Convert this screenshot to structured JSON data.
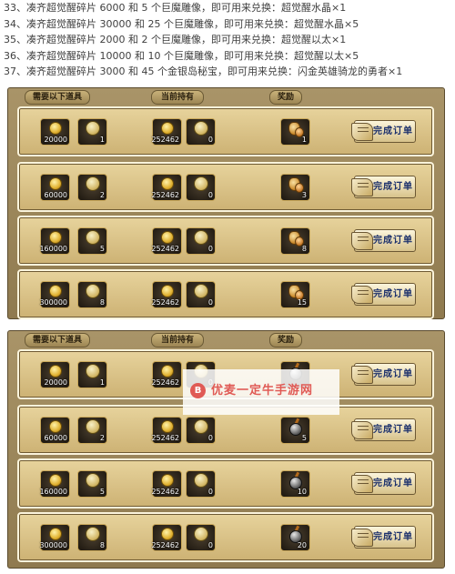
{
  "intro_lines": [
    "33、凑齐超觉醒碎片 6000 和 5 个巨魔雕像，即可用来兑换：超觉醒水晶×1",
    "34、凑齐超觉醒碎片 30000 和 25 个巨魔雕像，即可用来兑换：超觉醒水晶×5",
    "35、凑齐超觉醒碎片 2000 和 2 个巨魔雕像，即可用来兑换：超觉醒以太×1",
    "36、凑齐超觉醒碎片 10000 和 10 个巨魔雕像，即可用来兑换：超觉醒以太×5",
    "37、凑齐超觉醒碎片 3000 和 45 个金银岛秘宝，即可用来兑换：闪金英雄骑龙的勇者×1"
  ],
  "panels": [
    {
      "headers": {
        "required": "需要以下道具",
        "held": "当前持有",
        "reward": "奖励"
      },
      "button_label": "完成订单",
      "rows": [
        {
          "req1": "20000",
          "req2": "1",
          "held1": "252462",
          "held2": "0",
          "reward_count": "1",
          "reward_icon": "bag-icon"
        },
        {
          "req1": "60000",
          "req2": "2",
          "held1": "252462",
          "held2": "0",
          "reward_count": "3",
          "reward_icon": "bag-icon"
        },
        {
          "req1": "160000",
          "req2": "5",
          "held1": "252462",
          "held2": "0",
          "reward_count": "8",
          "reward_icon": "bag-icon"
        },
        {
          "req1": "300000",
          "req2": "8",
          "held1": "252462",
          "held2": "0",
          "reward_count": "15",
          "reward_icon": "bag-icon"
        }
      ]
    },
    {
      "headers": {
        "required": "需要以下道具",
        "held": "当前持有",
        "reward": "奖励"
      },
      "button_label": "完成订单",
      "rows": [
        {
          "req1": "20000",
          "req2": "1",
          "held1": "252462",
          "held2": "0",
          "reward_count": "",
          "reward_icon": "bomb-icon"
        },
        {
          "req1": "60000",
          "req2": "2",
          "held1": "252462",
          "held2": "0",
          "reward_count": "5",
          "reward_icon": "bomb-icon"
        },
        {
          "req1": "160000",
          "req2": "5",
          "held1": "252462",
          "held2": "0",
          "reward_count": "10",
          "reward_icon": "bomb-icon"
        },
        {
          "req1": "300000",
          "req2": "8",
          "held1": "252462",
          "held2": "0",
          "reward_count": "20",
          "reward_icon": "bomb-icon"
        }
      ]
    }
  ],
  "watermark": {
    "text": "优麦一定牛手游网",
    "logo_letter": "B"
  }
}
